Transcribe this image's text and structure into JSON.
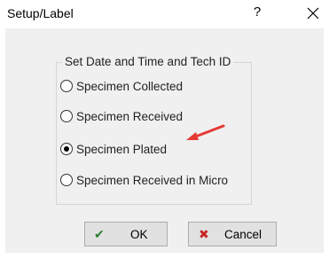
{
  "window": {
    "title": "Setup/Label",
    "help_glyph": "?",
    "close_glyph": "close-x"
  },
  "group": {
    "legend": "Set Date and Time and Tech ID"
  },
  "options": [
    {
      "label": "Specimen Collected",
      "checked": false
    },
    {
      "label": "Specimen Received",
      "checked": false
    },
    {
      "label": "Specimen Plated",
      "checked": true
    },
    {
      "label": "Specimen Received in Micro",
      "checked": false
    }
  ],
  "buttons": {
    "ok_label": "OK",
    "ok_icon": "checkmark-icon",
    "cancel_label": "Cancel",
    "cancel_icon": "x-mark-icon"
  },
  "colors": {
    "annotation_arrow": "#e53935",
    "ok_check": "#2e7d32",
    "cancel_x": "#c62828"
  }
}
